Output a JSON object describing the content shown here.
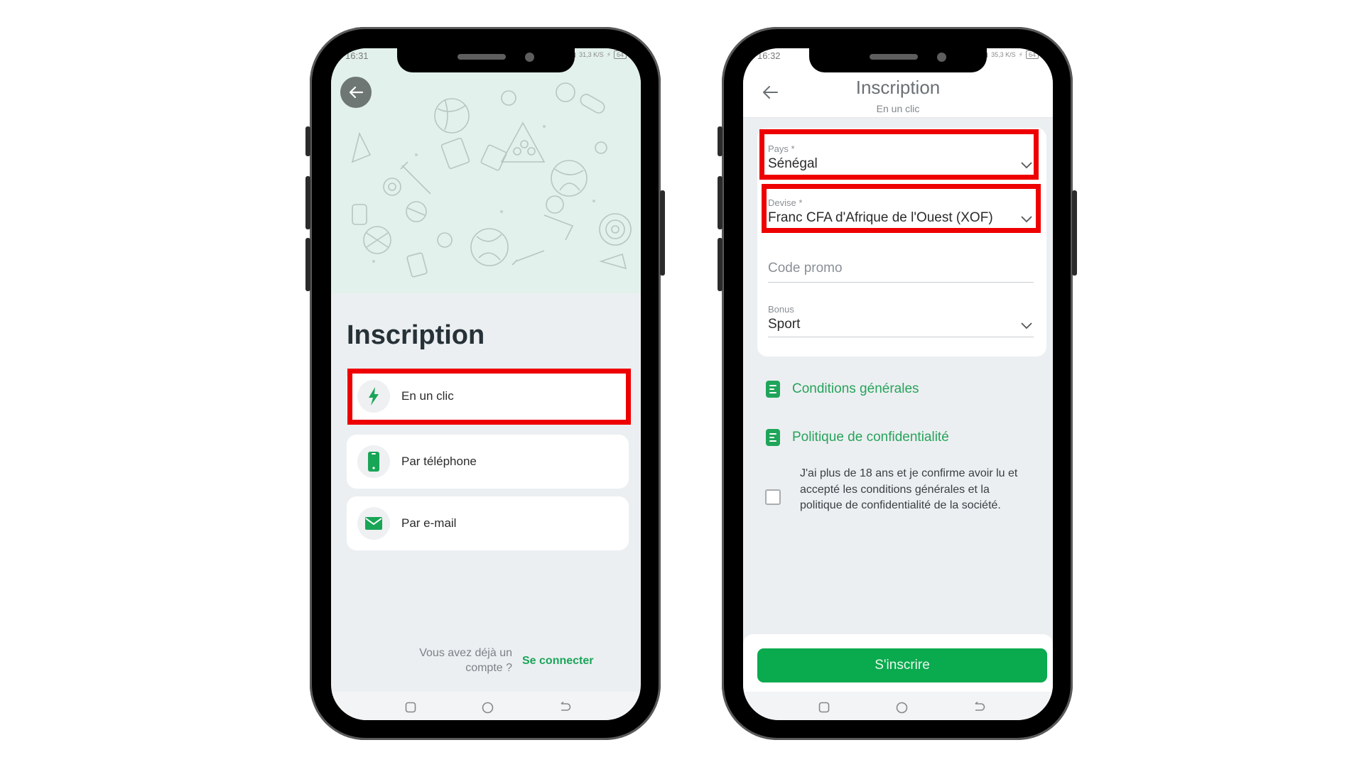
{
  "left_phone": {
    "status": {
      "time": "16:31",
      "net_speed": "31,3 K/S",
      "battery": "64"
    },
    "back_button": "back-arrow-icon",
    "title": "Inscription",
    "options": [
      {
        "label": "En un clic",
        "icon": "lightning-icon",
        "highlighted": true
      },
      {
        "label": "Par téléphone",
        "icon": "phone-icon",
        "highlighted": false
      },
      {
        "label": "Par e-mail",
        "icon": "mail-icon",
        "highlighted": false
      }
    ],
    "footer": {
      "question_line1": "Vous avez déjà un",
      "question_line2": "compte ?",
      "link": "Se connecter"
    }
  },
  "right_phone": {
    "status": {
      "time": "16:32",
      "net_speed": "35,3 K/S",
      "battery": "64"
    },
    "header": {
      "title": "Inscription",
      "subtitle": "En un clic"
    },
    "form": {
      "pays": {
        "label": "Pays *",
        "value": "Sénégal",
        "highlighted": true
      },
      "devise": {
        "label": "Devise *",
        "value": "Franc CFA d'Afrique de l'Ouest (XOF)",
        "highlighted": true
      },
      "code_promo": {
        "placeholder": "Code promo",
        "value": ""
      },
      "bonus": {
        "label": "Bonus",
        "value": "Sport"
      }
    },
    "links": {
      "conditions": "Conditions générales",
      "privacy": "Politique de confidentialité"
    },
    "consent": {
      "text": "J'ai plus de 18 ans et je confirme avoir lu et accepté les conditions générales et la politique de confidentialité de la société.",
      "checked": false
    },
    "submit_label": "S'inscrire"
  },
  "colors": {
    "accent_green": "#0aaa4e",
    "highlight_red": "#ee0000",
    "title_dark": "#263238"
  }
}
